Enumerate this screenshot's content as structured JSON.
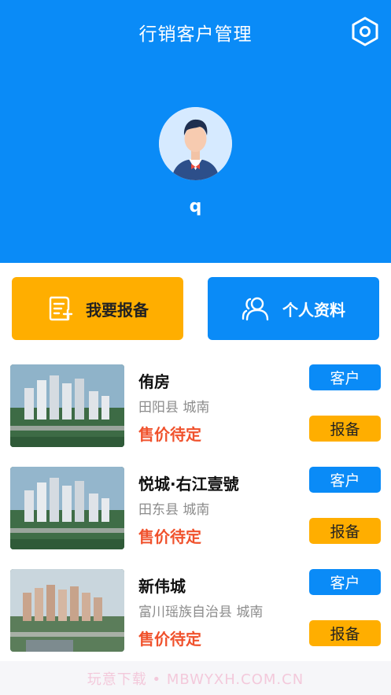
{
  "header": {
    "title": "行销客户管理",
    "settings_icon": "gear-hexagon-icon",
    "avatar_icon": "user-avatar-icon",
    "username": "q",
    "background": "#0a8bf7"
  },
  "actions": {
    "report_label": "我要报备",
    "report_icon": "document-add-icon",
    "profile_label": "个人资料",
    "profile_icon": "users-icon",
    "report_color": "#ffae00",
    "profile_color": "#0a8bf7"
  },
  "listings": [
    {
      "name": "侑房",
      "location": "田阳县 城南",
      "price": "售价待定",
      "customer_label": "客户",
      "report_label": "报备"
    },
    {
      "name": "悦城·右江壹號",
      "location": "田东县 城南",
      "price": "售价待定",
      "customer_label": "客户",
      "report_label": "报备"
    },
    {
      "name": "新伟城",
      "location": "富川瑶族自治县 城南",
      "price": "售价待定",
      "customer_label": "客户",
      "report_label": "报备"
    }
  ],
  "watermark": "玩意下载 • MBWYXH.COM.CN"
}
